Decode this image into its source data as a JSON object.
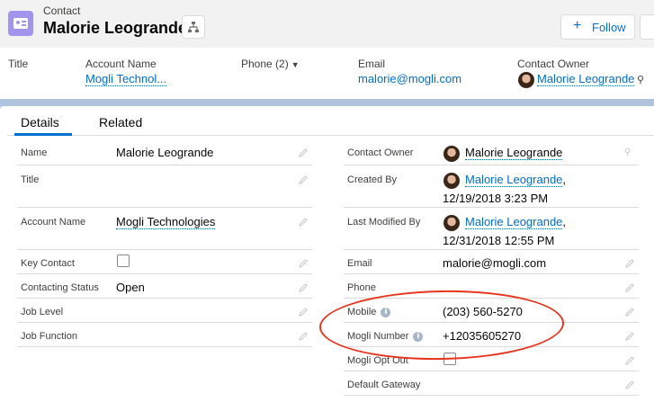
{
  "header": {
    "object_type": "Contact",
    "record_name": "Malorie Leogrande",
    "follow_label": "Follow",
    "follow_icon": "plus-icon"
  },
  "highlights": {
    "title_label": "Title",
    "account_label": "Account Name",
    "account_value": "Mogli Technol...",
    "phone_label": "Phone (2)",
    "email_label": "Email",
    "email_value": "malorie@mogli.com",
    "owner_label": "Contact Owner",
    "owner_value": "Malorie Leogrande"
  },
  "tabs": [
    {
      "label": "Details",
      "active": true
    },
    {
      "label": "Related",
      "active": false
    }
  ],
  "details": {
    "left": [
      {
        "label": "Name",
        "value": "Malorie Leogrande"
      },
      {
        "label": "Title",
        "value": ""
      },
      {
        "label": "Account Name",
        "value": "Mogli Technologies"
      },
      {
        "label": "Key Contact",
        "value": ""
      },
      {
        "label": "Contacting Status",
        "value": "Open"
      },
      {
        "label": "Job Level",
        "value": ""
      },
      {
        "label": "Job Function",
        "value": ""
      }
    ],
    "right": [
      {
        "label": "Contact Owner",
        "value": "Malorie Leogrande"
      },
      {
        "label": "Created By",
        "value": "Malorie Leogrande",
        "suffix": ",",
        "date": "12/19/2018 3:23 PM"
      },
      {
        "label": "Last Modified By",
        "value": "Malorie Leogrande",
        "suffix": ",",
        "date": "12/31/2018 12:55 PM"
      },
      {
        "label": "Email",
        "value": "malorie@mogli.com"
      },
      {
        "label": "Phone",
        "value": ""
      },
      {
        "label": "Mobile",
        "value": "(203) 560-5270"
      },
      {
        "label": "Mogli Number",
        "value": "+12035605270"
      },
      {
        "label": "Mogli Opt Out",
        "value": ""
      },
      {
        "label": "Default Gateway",
        "value": ""
      }
    ]
  },
  "colors": {
    "link": "#006dcc",
    "accent": "#0070d2",
    "annotation": "#e8341c",
    "contact_icon": "#a094ed"
  }
}
